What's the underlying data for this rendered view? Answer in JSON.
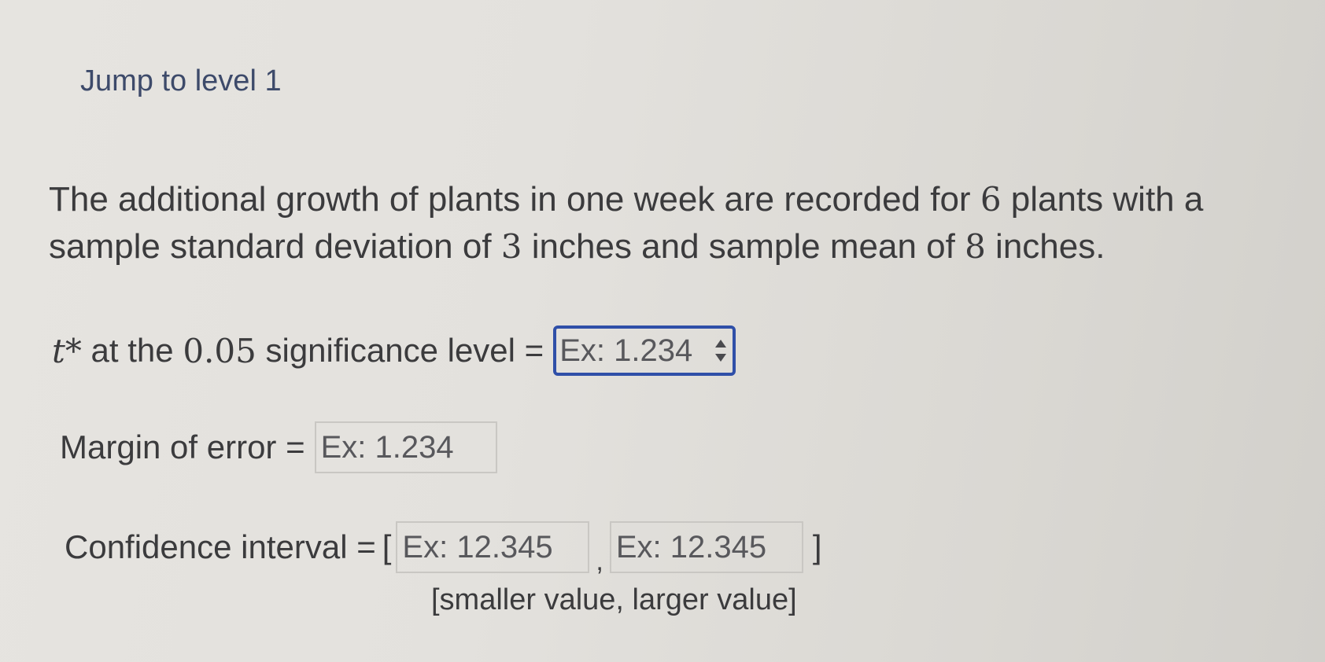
{
  "header": {
    "jump_link": "Jump to level 1"
  },
  "problem": {
    "text_part1": "The additional growth of plants in one week are recorded for ",
    "n_plants": "6",
    "text_part2": " plants with a sample standard deviation of ",
    "std_dev": "3",
    "text_part3": " inches and sample mean of ",
    "mean": "8",
    "text_part4": " inches."
  },
  "tstar_row": {
    "symbol": "t*",
    "label_part1": " at the ",
    "significance": "0.05",
    "label_part2": " significance level =",
    "placeholder": "Ex: 1.234",
    "spinner_icon": "up-down-spinner-icon"
  },
  "moe_row": {
    "label": "Margin of error =",
    "placeholder": "Ex: 1.234"
  },
  "ci_row": {
    "label": "Confidence interval =",
    "open_bracket": "[",
    "lower_placeholder": "Ex: 12.345",
    "separator": ",",
    "upper_placeholder": "Ex: 12.345",
    "close_bracket": "]",
    "hint": "[smaller value, larger value]"
  },
  "colors": {
    "focus_border": "#2f4fa8",
    "link": "#3d4a6a",
    "text": "#3b3b3d"
  }
}
